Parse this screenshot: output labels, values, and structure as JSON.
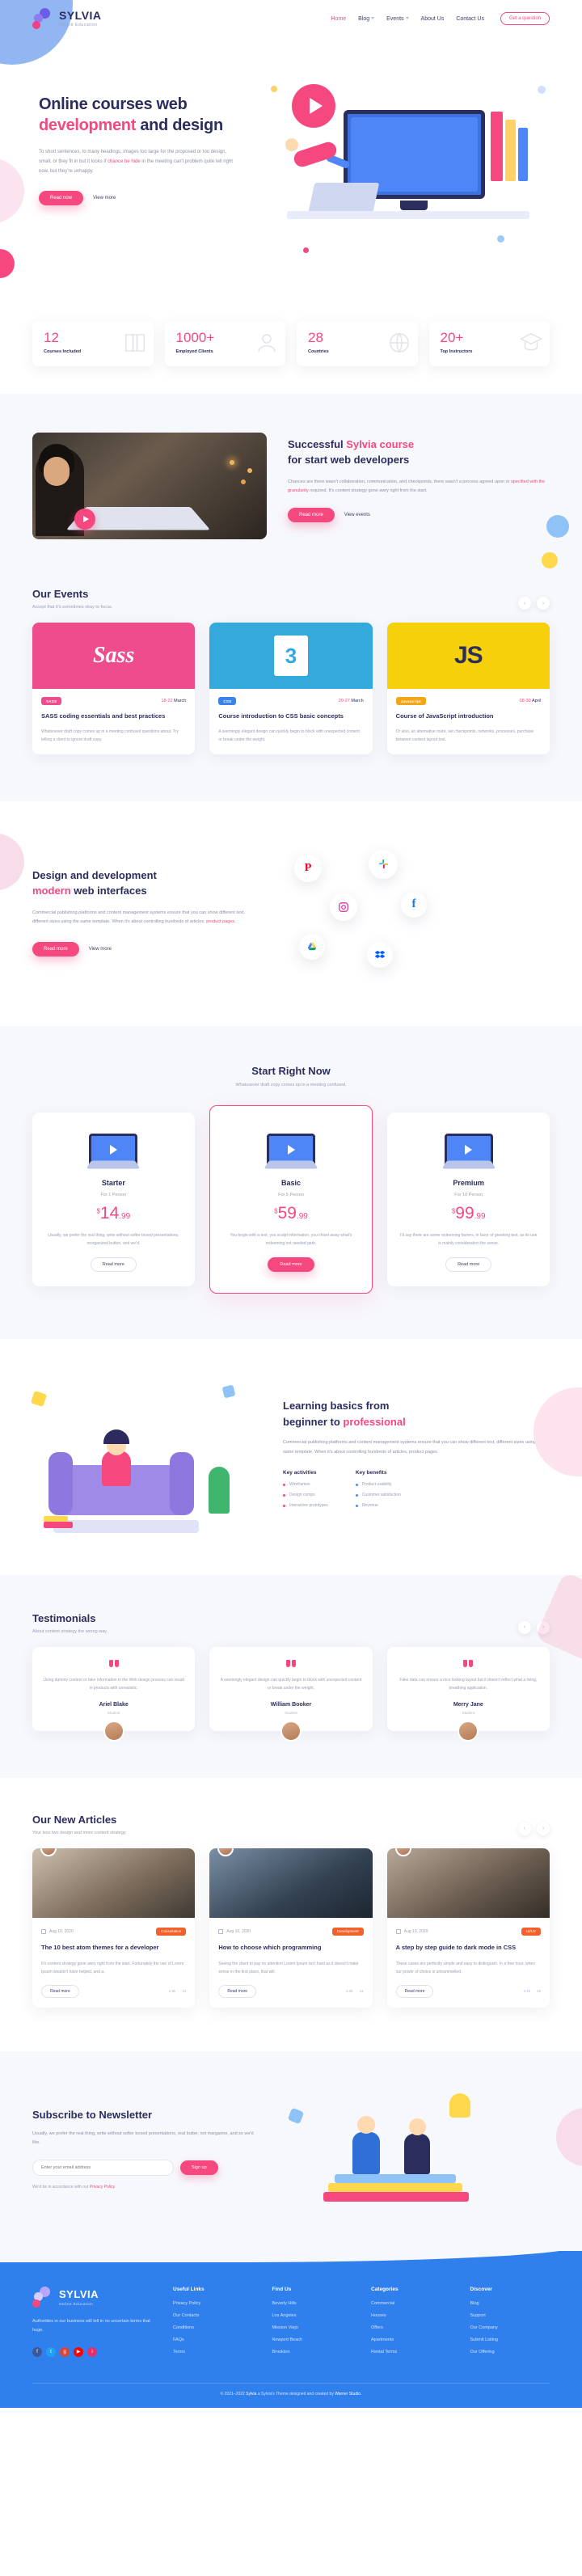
{
  "header": {
    "brand": {
      "name": "SYLVIA",
      "tagline": "Online Education"
    },
    "nav": [
      {
        "label": "Home",
        "active": true,
        "dropdown": false
      },
      {
        "label": "Blog",
        "active": false,
        "dropdown": true
      },
      {
        "label": "Events",
        "active": false,
        "dropdown": true
      },
      {
        "label": "About Us",
        "active": false,
        "dropdown": false
      },
      {
        "label": "Contact Us",
        "active": false,
        "dropdown": false
      }
    ],
    "cta": "Get a question"
  },
  "hero": {
    "title_line1": "Online courses web",
    "title_pink": "development",
    "title_line2_rest": " and design",
    "paragraph_a": "To short sentences, to many headings, images too large for the proposed or too design, small, or they fit in but it looks if ",
    "paragraph_link": "chance be hide",
    "paragraph_b": " in the meeting can't problem quite tell right now, but they're unhappy.",
    "btn_primary": "Read now",
    "btn_secondary": "View more"
  },
  "stats": [
    {
      "number": "12",
      "label": "Courses Included",
      "icon": "book-icon"
    },
    {
      "number": "1000+",
      "label": "Employed Clients",
      "icon": "people-icon"
    },
    {
      "number": "28",
      "label": "Countries",
      "icon": "globe-icon"
    },
    {
      "number": "20+",
      "label": "Top Instructors",
      "icon": "teacher-icon"
    }
  ],
  "success": {
    "title_a": "Successful ",
    "title_pink": "Sylvia course",
    "title_b": "for start web developers",
    "paragraph_a": "Chances are there wasn't collaboration, communication, and checkpoints, there wasn't a process agreed upon or ",
    "paragraph_link": "specified with the granularity",
    "paragraph_b": " required. It's content strategy gone awry right from the start.",
    "btn_primary": "Read more",
    "btn_secondary": "View events"
  },
  "events": {
    "title": "Our Events",
    "subtitle": "Accept that it's sometimes okay to focus.",
    "cards": [
      {
        "logo": "Sass",
        "logo_kind": "sass",
        "tag": "SASS",
        "date_range": "18-22",
        "date_month": "March",
        "title": "SASS coding essentials and best practices",
        "desc": "Whatsoever draft copy comes up in a meeting confused questions about. Try telling a client to ignore draft copy."
      },
      {
        "logo": "3",
        "logo_kind": "css",
        "tag": "CSS",
        "date_range": "20-27",
        "date_month": "March",
        "title": "Course introduction to CSS basic concepts",
        "desc": "A seemingly elegant design can quickly begin to block with unexpected content or break under the weight."
      },
      {
        "logo": "JS",
        "logo_kind": "js",
        "tag": "Javascript",
        "date_range": "08-30",
        "date_month": "April",
        "title": "Course of JavaScript introduction",
        "desc": "Or also, an alternative route, set checkpoints, networks, processes, purchase between content layout tool."
      }
    ]
  },
  "design_dev": {
    "title_line1": "Design and development",
    "title_pink": "modern",
    "title_line2_rest": " web interfaces",
    "paragraph_a": "Commercial publishing platforms and content management systems ensure that you can show different text, different sizes using the same template. When it's about controlling hundreds of articles, ",
    "paragraph_link": "product pages",
    "paragraph_b": ".",
    "btn_primary": "Read more",
    "btn_secondary": "View more",
    "bubbles": [
      "pinterest-icon",
      "slack-icon",
      "instagram-icon",
      "facebook-icon",
      "drive-icon",
      "dropbox-icon"
    ]
  },
  "pricing": {
    "title": "Start Right Now",
    "subtitle": "Whatsoever draft copy comes up in a meeting confused.",
    "plans": [
      {
        "name": "Starter",
        "for": "For 1 Person",
        "currency": "$",
        "price": "14",
        "cents": ".99",
        "desc": "Usually, we prefer the real thing, write without softer boxed presentations, reorganized button, and we'd.",
        "button": "Read more",
        "featured": false
      },
      {
        "name": "Basic",
        "for": "For 5 Person",
        "currency": "$",
        "price": "59",
        "cents": ".99",
        "desc": "You begin with a text, you sculpt information, you chisel away what's redeeming not needed garb.",
        "button": "Read more",
        "featured": true
      },
      {
        "name": "Premium",
        "for": "For 10 Person",
        "currency": "$",
        "price": "99",
        "cents": ".99",
        "desc": "I'd say there are some redeeming factors, in favor of greeking text, as its use is mainly consideration the sense.",
        "button": "Read more",
        "featured": false
      }
    ]
  },
  "learning": {
    "title_line1": "Learning basics from",
    "title_line2": "beginner to ",
    "title_pink": "professional",
    "paragraph": "Commercial publishing platforms and content management systems ensure that you can show different text, different sizes using the same template. When it's about controlling hundreds of articles, product pages.",
    "col1_title": "Key activities",
    "col1_items": [
      "Wireframes",
      "Design comps",
      "Interactive prototypes"
    ],
    "col2_title": "Key benefits",
    "col2_items": [
      "Product usability",
      "Customer satisfaction",
      "Revenue"
    ]
  },
  "testimonials": {
    "title": "Testimonials",
    "subtitle": "About content strategy the wrong way.",
    "cards": [
      {
        "text": "Using dummy content or fake information in the Web design process can result in products with unrealistic.",
        "name": "Ariel Blake",
        "role": "Student"
      },
      {
        "text": "A seemingly elegant design can quickly begin to block with unexpected content or break under the weight.",
        "name": "William Booker",
        "role": "Student"
      },
      {
        "text": "Fake data can ensure a nice looking layout but it doesn't reflect what a living, breathing application.",
        "name": "Merry Jane",
        "role": "Student"
      }
    ]
  },
  "articles": {
    "title": "Our New Articles",
    "subtitle": "Your less two design and more content strategy.",
    "cards": [
      {
        "date": "Aug 10, 2020",
        "badge": "Consultation",
        "title": "The 10 best atom themes for a developer",
        "desc": "It's content strategy gone awry right from the start. Fortunately the use of Lorem Ipsum wouldn't have helped, and a.",
        "button": "Read more",
        "views": "1.5k",
        "comments": "21"
      },
      {
        "date": "Aug 10, 2020",
        "badge": "Development",
        "title": "How to choose which programming",
        "desc": "Seeing the client to pay no attention Lorem Ipsum isn't hard as it doesn't make sense in the first place, that will.",
        "button": "Read more",
        "views": "2.3k",
        "comments": "14"
      },
      {
        "date": "Aug 10, 2020",
        "badge": "UI/UX",
        "title": "A step by step guide to dark mode in CSS",
        "desc": "These cases are perfectly simple and easy to distinguish. In a free hour, when our power of choice is untrammelled.",
        "button": "Read more",
        "views": "3.1k",
        "comments": "32"
      }
    ]
  },
  "newsletter": {
    "title": "Subscribe to Newsletter",
    "paragraph": "Usually, we prefer the real thing, write without softer boxed presentations, real butter, not margarine, and so we'd like.",
    "input_placeholder": "Enter your email address",
    "button": "Sign up",
    "note_a": "We'd be in accordance with our ",
    "note_link": "Privacy Policy",
    "note_b": "."
  },
  "footer": {
    "brand": {
      "name": "SYLVIA",
      "tagline": "Online Education"
    },
    "about": "Authorities in our business will tell in no uncertain terms that huge.",
    "social": [
      "facebook-icon",
      "twitter-icon",
      "google-plus-icon",
      "youtube-icon",
      "instagram-icon"
    ],
    "columns": [
      {
        "title": "Useful Links",
        "links": [
          "Privacy Policy",
          "Our Contacts",
          "Conditions",
          "FAQs",
          "Terms"
        ]
      },
      {
        "title": "Find Us",
        "links": [
          "Beverly Hills",
          "Los Angeles",
          "Mission Viejo",
          "Newport Beach",
          "Brookton"
        ]
      },
      {
        "title": "Categories",
        "links": [
          "Commercial",
          "Houses",
          "Offers",
          "Apartments",
          "Rental Terms"
        ]
      },
      {
        "title": "Discover",
        "links": [
          "Blog",
          "Support",
          "Our Company",
          "Submit Listing",
          "Our Offering"
        ]
      }
    ],
    "copyright_a": "© 2021–2022 ",
    "copyright_brand": "Sylvia",
    "copyright_b": " a Sylvia's Theme designed and created by ",
    "copyright_author": "Warner Studio",
    "copyright_c": "."
  }
}
